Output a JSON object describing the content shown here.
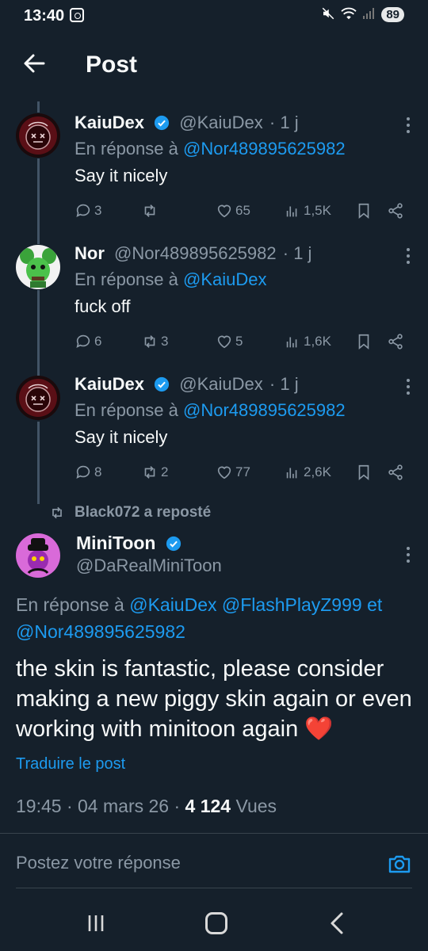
{
  "status_bar": {
    "time": "13:40",
    "battery": "89"
  },
  "header": {
    "title": "Post"
  },
  "thread": [
    {
      "name": "KaiuDex",
      "verified": true,
      "handle": "@KaiuDex",
      "time": "· 1 j",
      "reply_prefix": "En réponse à",
      "reply_to": "@Nor489895625982",
      "text": "Say it nicely",
      "replies": "3",
      "reposts": "",
      "likes": "65",
      "views": "1,5K"
    },
    {
      "name": "Nor",
      "verified": false,
      "handle": "@Nor489895625982",
      "time": "· 1 j",
      "reply_prefix": "En réponse à",
      "reply_to": "@KaiuDex",
      "text": "fuck off",
      "replies": "6",
      "reposts": "3",
      "likes": "5",
      "views": "1,6K"
    },
    {
      "name": "KaiuDex",
      "verified": true,
      "handle": "@KaiuDex",
      "time": "· 1 j",
      "reply_prefix": "En réponse à",
      "reply_to": "@Nor489895625982",
      "text": "Say it nicely",
      "replies": "8",
      "reposts": "2",
      "likes": "77",
      "views": "2,6K"
    }
  ],
  "repost_banner": "Black072 a reposté",
  "main_post": {
    "name": "MiniToon",
    "verified": true,
    "handle": "@DaRealMiniToon",
    "reply_prefix": "En réponse à",
    "reply_mentions": [
      "@KaiuDex",
      "@FlashPlayZ999"
    ],
    "reply_joiner": "et",
    "reply_last": "@Nor489895625982",
    "text": "the skin is fantastic, please consider making a new piggy skin again or even working with minitoon again",
    "heart_emoji": "❤️",
    "translate_label": "Traduire le post",
    "time": "19:45",
    "date": "04 mars 26",
    "views_count": "4 124",
    "views_label": "Vues"
  },
  "composer": {
    "placeholder": "Postez votre réponse"
  },
  "colors": {
    "background": "#15202b",
    "accent": "#1d9bf0",
    "muted": "#8b98a5",
    "heart": "#f91880"
  }
}
